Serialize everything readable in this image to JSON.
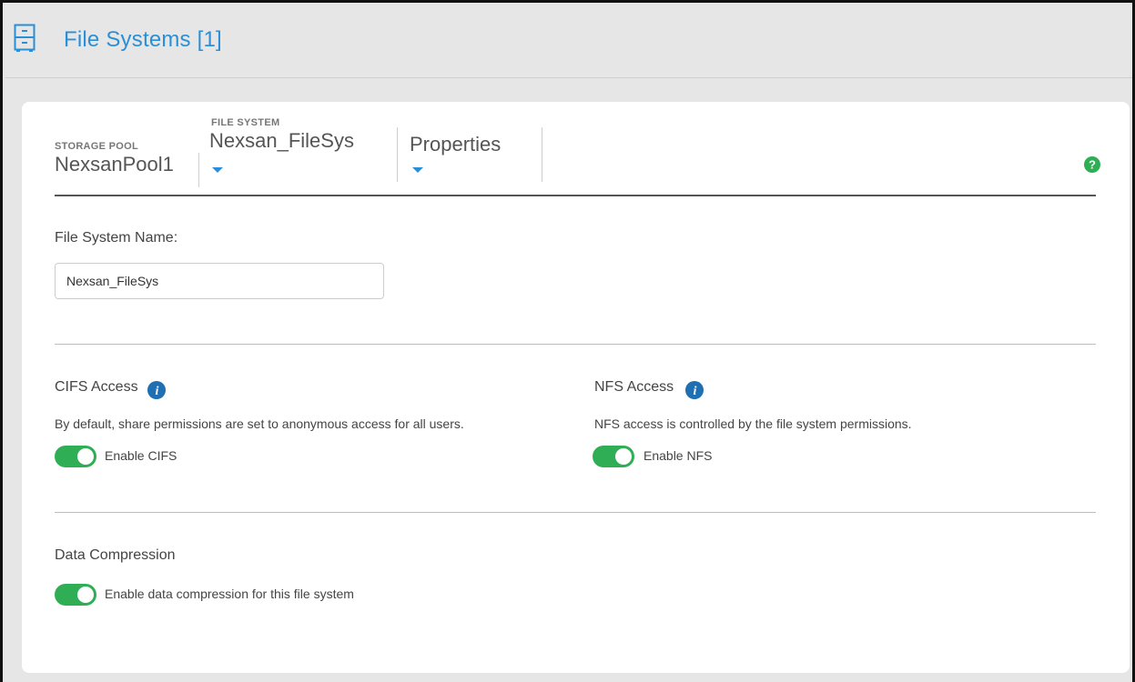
{
  "header": {
    "title": "File Systems [1]",
    "icon": "file-cabinet-icon",
    "title_color": "#2a8fd6"
  },
  "breadcrumb": {
    "storage_pool_label": "STORAGE POOL",
    "storage_pool_value": "NexsanPool1",
    "file_system_label": "FILE SYSTEM",
    "file_system_value": "Nexsan_FileSys",
    "view_value": "Properties",
    "help_icon": "question-circle-icon"
  },
  "form": {
    "fs_name_label": "File System Name:",
    "fs_name_value": "Nexsan_FileSys"
  },
  "cifs": {
    "title": "CIFS Access",
    "description": "By default, share permissions are set to anonymous access for all users.",
    "toggle_label": "Enable CIFS",
    "enabled": true
  },
  "nfs": {
    "title": "NFS Access",
    "description": "NFS access is controlled by the file system permissions.",
    "toggle_label": "Enable NFS",
    "enabled": true
  },
  "compression": {
    "title": "Data Compression",
    "toggle_label": "Enable data compression for this file system",
    "enabled": true
  },
  "colors": {
    "accent": "#2a8fd6",
    "toggle_on": "#2fae55",
    "help": "#2fae55"
  }
}
